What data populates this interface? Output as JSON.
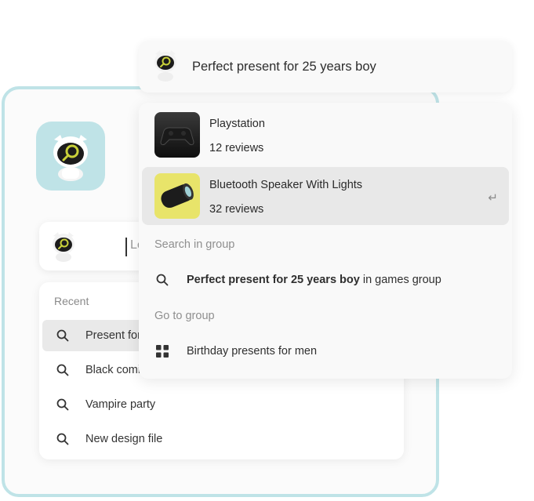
{
  "search": {
    "placeholder": "Let me h",
    "query": "Perfect present for 25 years boy"
  },
  "recent": {
    "title": "Recent",
    "items": [
      {
        "label": "Present for"
      },
      {
        "label": "Black comi"
      },
      {
        "label": "Vampire party"
      },
      {
        "label": "New design file"
      }
    ]
  },
  "results": {
    "products": [
      {
        "name": "Playstation",
        "reviews": "12 reviews",
        "thumb": "gamepad-thumbnail"
      },
      {
        "name": "Bluetooth Speaker With Lights",
        "reviews": "32 reviews",
        "thumb": "speaker-thumbnail"
      }
    ],
    "enter_hint": "↵",
    "search_in_group": {
      "title": "Search in group",
      "query_bold": "Perfect present for 25 years boy",
      "suffix": " in games group"
    },
    "go_to_group": {
      "title": "Go to group",
      "group_name": "Birthday presents for men"
    }
  },
  "colors": {
    "accent": "#bfe3e7",
    "highlight": "#e8e8e8",
    "panel": "#f9f9f9"
  },
  "icons": [
    "mascot-search-icon",
    "search-icon",
    "grid-icon",
    "enter-icon"
  ]
}
